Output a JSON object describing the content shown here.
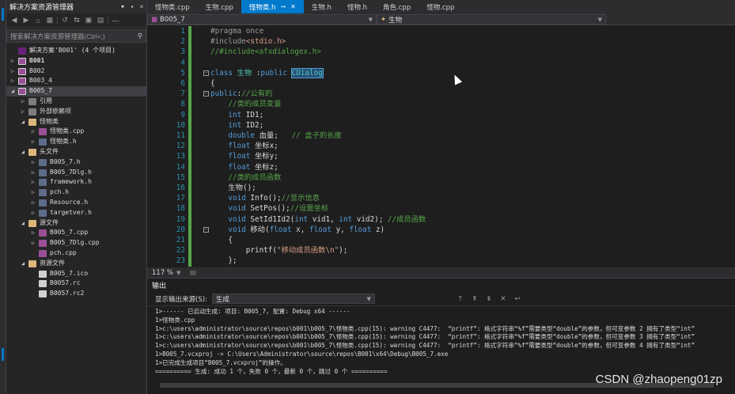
{
  "solution_explorer": {
    "title": "解决方案资源管理器",
    "title_icons": [
      "▾",
      "▪",
      "×"
    ],
    "search_placeholder": "搜索解决方案资源管理器(Ctrl+;)",
    "tree": [
      {
        "label": "解决方案'B001' (4 个项目)",
        "indent": 0,
        "arrow": "",
        "icon": "sol",
        "bold": false
      },
      {
        "label": "B001",
        "indent": 0,
        "arrow": "▷",
        "icon": "proj",
        "bold": true
      },
      {
        "label": "B002",
        "indent": 0,
        "arrow": "▷",
        "icon": "proj",
        "bold": false
      },
      {
        "label": "B003_4",
        "indent": 0,
        "arrow": "▷",
        "icon": "proj",
        "bold": false
      },
      {
        "label": "B005_7",
        "indent": 0,
        "arrow": "◢",
        "icon": "proj",
        "bold": false,
        "selected": true
      },
      {
        "label": "引用",
        "indent": 1,
        "arrow": "▷",
        "icon": "ref"
      },
      {
        "label": "外部依赖项",
        "indent": 1,
        "arrow": "▷",
        "icon": "ref"
      },
      {
        "label": "怪物类",
        "indent": 1,
        "arrow": "◢",
        "icon": "folder"
      },
      {
        "label": "怪物类.cpp",
        "indent": 2,
        "arrow": "▷",
        "icon": "cpp"
      },
      {
        "label": "怪物类.h",
        "indent": 2,
        "arrow": "▷",
        "icon": "h"
      },
      {
        "label": "头文件",
        "indent": 1,
        "arrow": "◢",
        "icon": "folder"
      },
      {
        "label": "B005_7.h",
        "indent": 2,
        "arrow": "▷",
        "icon": "h"
      },
      {
        "label": "B005_7Dlg.h",
        "indent": 2,
        "arrow": "▷",
        "icon": "h"
      },
      {
        "label": "framework.h",
        "indent": 2,
        "arrow": "▷",
        "icon": "h"
      },
      {
        "label": "pch.h",
        "indent": 2,
        "arrow": "▷",
        "icon": "h"
      },
      {
        "label": "Resource.h",
        "indent": 2,
        "arrow": "▷",
        "icon": "h"
      },
      {
        "label": "targetver.h",
        "indent": 2,
        "arrow": "▷",
        "icon": "h"
      },
      {
        "label": "源文件",
        "indent": 1,
        "arrow": "◢",
        "icon": "folder"
      },
      {
        "label": "B005_7.cpp",
        "indent": 2,
        "arrow": "▷",
        "icon": "cpp"
      },
      {
        "label": "B005_7Dlg.cpp",
        "indent": 2,
        "arrow": "▷",
        "icon": "cpp"
      },
      {
        "label": "pch.cpp",
        "indent": 2,
        "arrow": "",
        "icon": "cpp"
      },
      {
        "label": "资源文件",
        "indent": 1,
        "arrow": "◢",
        "icon": "folder"
      },
      {
        "label": "B005_7.ico",
        "indent": 2,
        "arrow": "",
        "icon": "file"
      },
      {
        "label": "B0057.rc",
        "indent": 2,
        "arrow": "",
        "icon": "file"
      },
      {
        "label": "B0057.rc2",
        "indent": 2,
        "arrow": "",
        "icon": "file"
      }
    ]
  },
  "tabs": [
    {
      "label": "怪物类.cpp",
      "active": false
    },
    {
      "label": "生物.cpp",
      "active": false
    },
    {
      "label": "怪物类.h",
      "active": true
    },
    {
      "label": "生物.h",
      "active": false
    },
    {
      "label": "怪物.h",
      "active": false
    },
    {
      "label": "角色.cpp",
      "active": false
    },
    {
      "label": "怪物.cpp",
      "active": false
    }
  ],
  "nav": {
    "scope": "B005_7",
    "member": "生物"
  },
  "editor": {
    "lines": [
      {
        "n": "1",
        "html": "<span class=\"c-pp\">#pragma once</span>"
      },
      {
        "n": "2",
        "html": "<span class=\"c-pp\">#include</span><span class=\"c-str\">&lt;stdio.h&gt;</span>"
      },
      {
        "n": "3",
        "html": "<span class=\"c-cm\">//#include&lt;afxdialogex.h&gt;</span>"
      },
      {
        "n": "4",
        "html": ""
      },
      {
        "n": "5",
        "html": "<span class=\"c-kw\">class</span> <span class=\"c-cls\">生物</span> :<span class=\"c-kw\">public</span> <span class=\"c-hl\">CDialog</span>",
        "fold": true
      },
      {
        "n": "6",
        "html": "{"
      },
      {
        "n": "7",
        "html": "<span class=\"c-kw\">public</span>:<span class=\"c-cm\">//公有的</span>",
        "fold": true
      },
      {
        "n": "8",
        "html": "    <span class=\"c-cm\">//类的成员变量</span>"
      },
      {
        "n": "9",
        "html": "    <span class=\"c-kw\">int</span> ID1;"
      },
      {
        "n": "10",
        "html": "    <span class=\"c-kw\">int</span> ID2;"
      },
      {
        "n": "11",
        "html": "    <span class=\"c-kw\">double</span> 血量;   <span class=\"c-cm\">// 盒子的长度</span>"
      },
      {
        "n": "12",
        "html": "    <span class=\"c-kw\">float</span> 坐标x;"
      },
      {
        "n": "13",
        "html": "    <span class=\"c-kw\">float</span> 坐标y;"
      },
      {
        "n": "14",
        "html": "    <span class=\"c-kw\">float</span> 坐标z;"
      },
      {
        "n": "15",
        "html": "    <span class=\"c-cm\">//类的成员函数</span>"
      },
      {
        "n": "16",
        "html": "    生物();"
      },
      {
        "n": "17",
        "html": "    <span class=\"c-kw\">void</span> Info();<span class=\"c-cm\">//显示信息</span>"
      },
      {
        "n": "18",
        "html": "    <span class=\"c-kw\">void</span> SetPos();<span class=\"c-cm\">//设置坐标</span>"
      },
      {
        "n": "19",
        "html": "    <span class=\"c-kw\">void</span> SetId1Id2(<span class=\"c-kw\">int</span> vid1, <span class=\"c-kw\">int</span> vid2); <span class=\"c-cm\">//成员函数</span>"
      },
      {
        "n": "20",
        "html": "    <span class=\"c-kw\">void</span> 移动(<span class=\"c-kw\">float</span> x, <span class=\"c-kw\">float</span> y, <span class=\"c-kw\">float</span> z)",
        "fold": true
      },
      {
        "n": "21",
        "html": "    {"
      },
      {
        "n": "22",
        "html": "        printf(<span class=\"c-str\">\"移动成员函数\\n\"</span>);"
      },
      {
        "n": "23",
        "html": "    };"
      }
    ]
  },
  "zoom": "117 %",
  "output": {
    "title": "输出",
    "source_label": "显示输出来源(S):",
    "source_value": "生成",
    "lines": [
      "1>------ 已启动生成: 项目: B005_7, 配置: Debug x64 ------",
      "1>怪物类.cpp",
      "1>c:\\users\\administrator\\source\\repos\\b001\\b005_7\\怪物类.cpp(15): warning C4477:  “printf”: 格式字符串“%f”需要类型“double”的参数，但可变参数 2 拥有了类型“int”",
      "1>c:\\users\\administrator\\source\\repos\\b001\\b005_7\\怪物类.cpp(15): warning C4477:  “printf”: 格式字符串“%f”需要类型“double”的参数，但可变参数 3 拥有了类型“int”",
      "1>c:\\users\\administrator\\source\\repos\\b001\\b005_7\\怪物类.cpp(15): warning C4477:  “printf”: 格式字符串“%f”需要类型“double”的参数，但可变参数 4 拥有了类型“int”",
      "1>B005_7.vcxproj -> C:\\Users\\Administrator\\source\\repos\\B001\\x64\\Debug\\B005_7.exe",
      "1>已完成生成项目“B005_7.vcxproj”的操作。",
      "========== 生成: 成功 1 个，失败 0 个，最新 0 个，跳过 0 个 =========="
    ]
  },
  "watermark": "CSDN @zhaopeng01zp"
}
